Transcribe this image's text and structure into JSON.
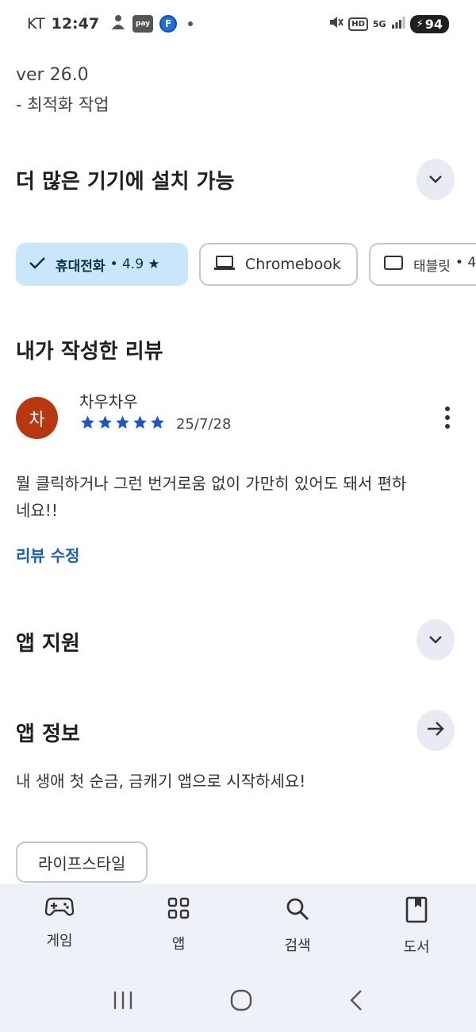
{
  "status_bar": {
    "carrier": "KT",
    "time": "12:47",
    "pay_label": "pay",
    "f_label": "F",
    "hd_label": "HD",
    "network_label": "5G",
    "battery": "94",
    "icons": [
      "person-icon",
      "pay-icon",
      "f-app-icon",
      "dot-icon",
      "mute-icon",
      "hd-icon",
      "network-5g-icon",
      "signal-icon",
      "battery-icon"
    ]
  },
  "release_notes": {
    "version": "ver 26.0",
    "note": "- 최적화 작업"
  },
  "devices_section": {
    "title": "더 많은 기기에 설치 가능",
    "chips": [
      {
        "label": "휴대전화",
        "rating": "• 4.9 ★",
        "selected": true,
        "icon": "check-icon"
      },
      {
        "label": "Chromebook",
        "selected": false,
        "icon": "laptop-icon"
      },
      {
        "label": "태블릿",
        "rating": "• 4",
        "selected": false,
        "icon": "tablet-icon"
      }
    ]
  },
  "my_review": {
    "title": "내가 작성한 리뷰",
    "avatar_letter": "차",
    "reviewer": "차우차우",
    "stars": 5,
    "date": "25/7/28",
    "text": "뭘 클릭하거나 그런 번거로움 없이 가만히 있어도 돼서 편하네요!!",
    "edit_label": "리뷰 수정"
  },
  "app_support": {
    "title": "앱 지원"
  },
  "app_info": {
    "title": "앱 정보",
    "description": "내 생애 첫 순금, 금캐기 앱으로 시작하세요!",
    "tag": "라이프스타일"
  },
  "bottom_nav": {
    "items": [
      {
        "label": "게임",
        "icon": "gamepad-icon"
      },
      {
        "label": "앱",
        "icon": "apps-grid-icon"
      },
      {
        "label": "검색",
        "icon": "search-icon"
      },
      {
        "label": "도서",
        "icon": "book-icon"
      }
    ]
  },
  "colors": {
    "accent": "#1a5fb4",
    "star": "#1a56c8",
    "chip_selected_bg": "#c9e6fb",
    "avatar_bg": "#b8370f",
    "nav_bg": "#eef1f8"
  }
}
